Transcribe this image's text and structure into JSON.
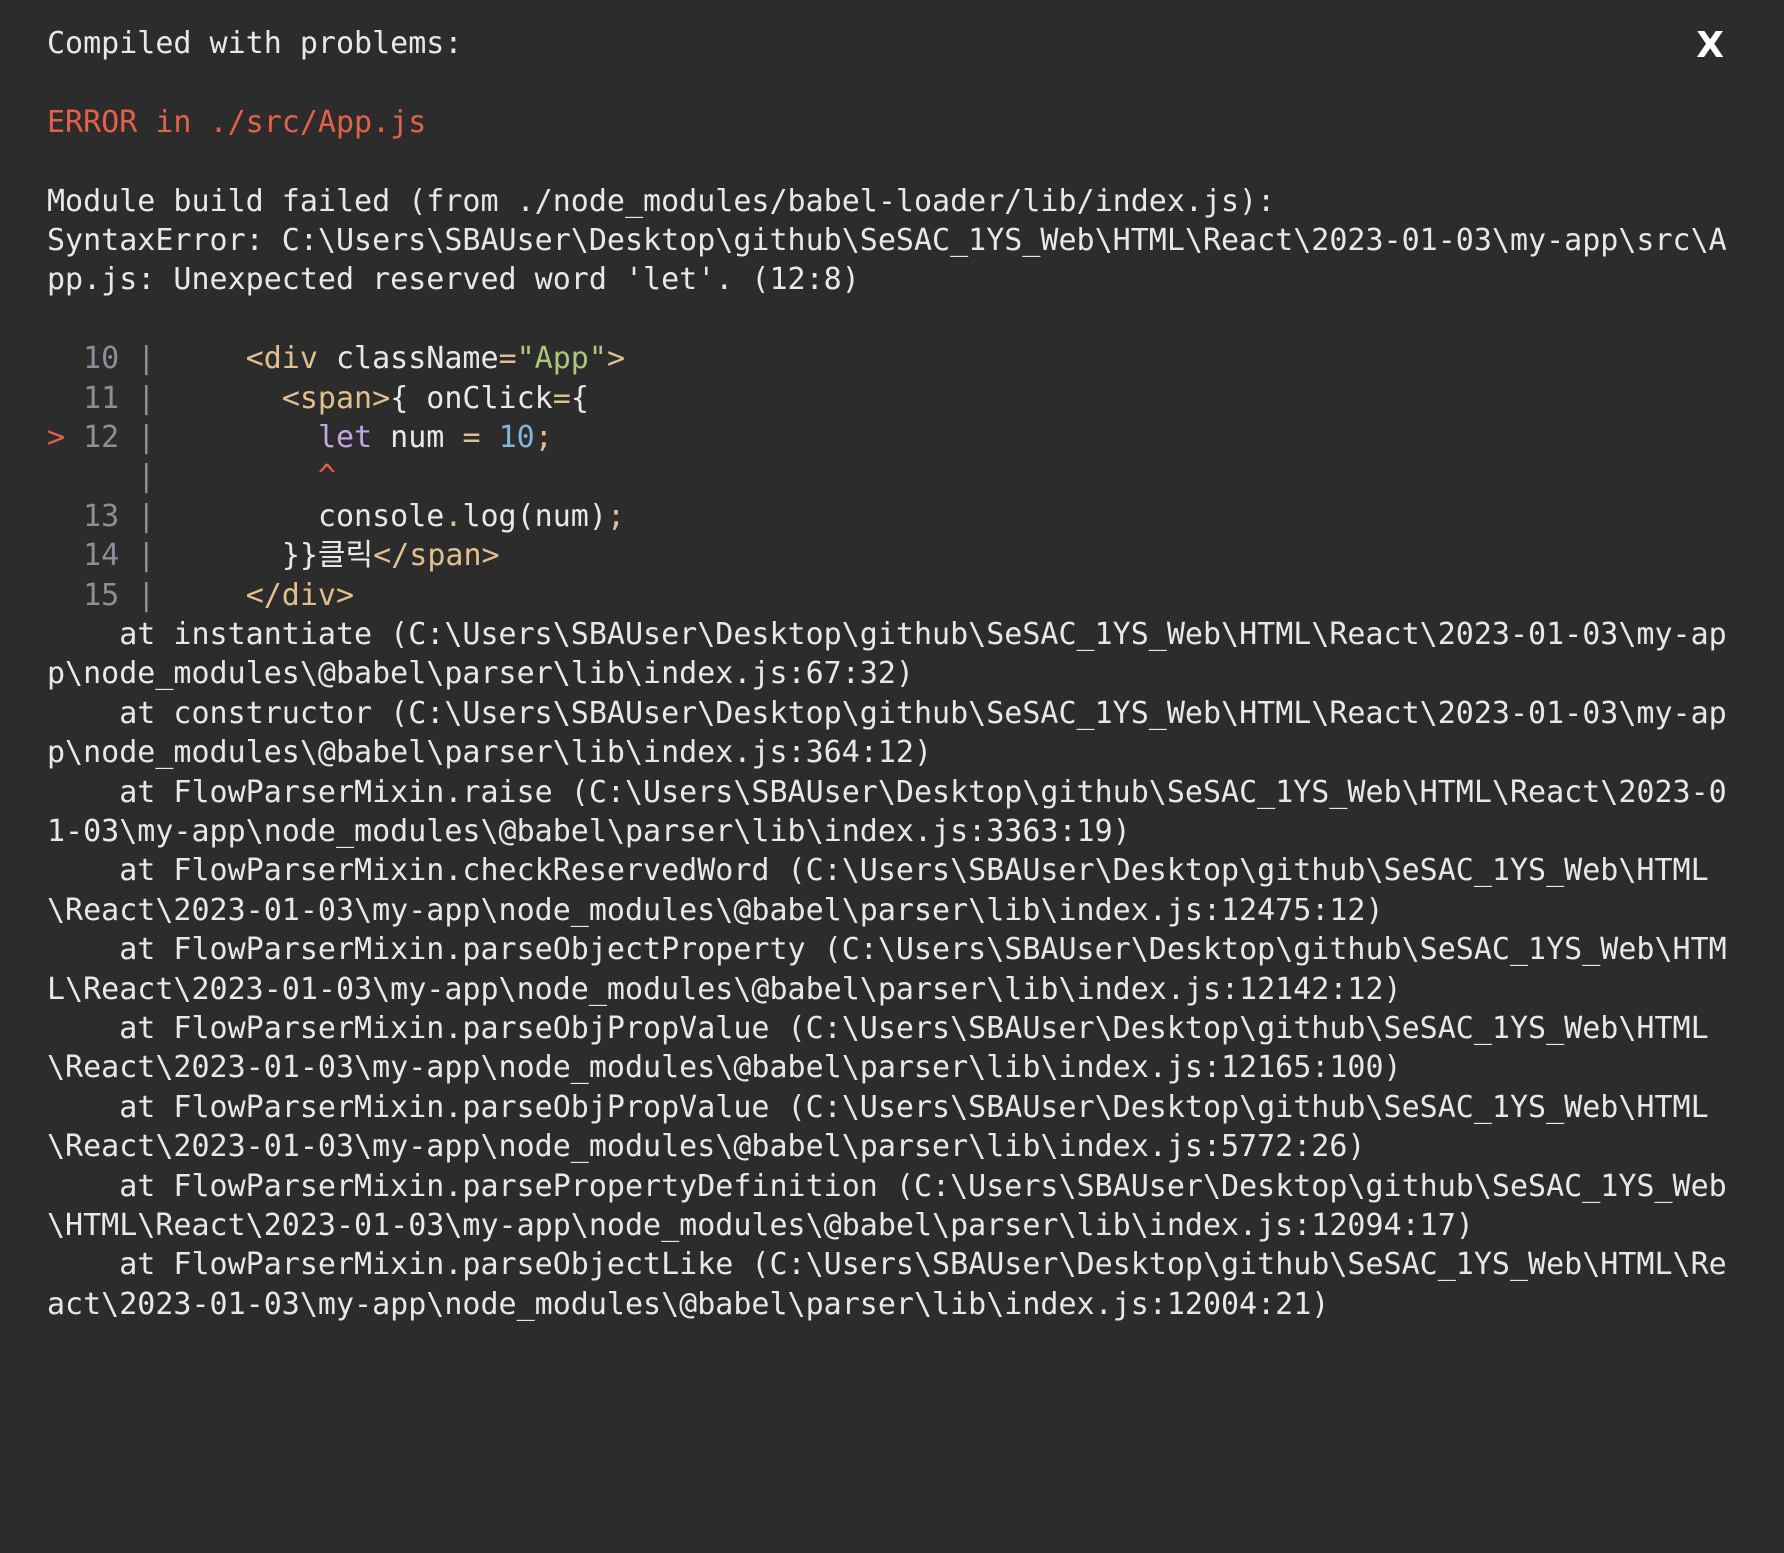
{
  "overlay": {
    "heading": "Compiled with problems:",
    "close_label": "X",
    "error_title": "ERROR in ./src/App.js",
    "message_lines": [
      "Module build failed (from ./node_modules/babel-loader/lib/index.js):",
      "SyntaxError: C:\\Users\\SBAUser\\Desktop\\github\\SeSAC_1YS_Web\\HTML\\React\\2023-01-03\\my-app\\src\\App.js: Unexpected reserved word 'let'. (12:8)"
    ],
    "code_frame": {
      "pointer": ">",
      "separator": "|",
      "caret": "^",
      "lines": [
        {
          "num": "10",
          "indent": "    ",
          "text": "<div className=\"App\">"
        },
        {
          "num": "11",
          "indent": "      ",
          "text": "<span>{ onClick={"
        },
        {
          "num": "12",
          "indent": "        ",
          "text": "let num = 10;"
        },
        {
          "num": "13",
          "indent": "        ",
          "text": "console.log(num);"
        },
        {
          "num": "14",
          "indent": "      ",
          "text": "}}클릭</span>"
        },
        {
          "num": "15",
          "indent": "    ",
          "text": "</div>"
        }
      ]
    },
    "stack": [
      "    at instantiate (C:\\Users\\SBAUser\\Desktop\\github\\SeSAC_1YS_Web\\HTML\\React\\2023-01-03\\my-app\\node_modules\\@babel\\parser\\lib\\index.js:67:32)",
      "    at constructor (C:\\Users\\SBAUser\\Desktop\\github\\SeSAC_1YS_Web\\HTML\\React\\2023-01-03\\my-app\\node_modules\\@babel\\parser\\lib\\index.js:364:12)",
      "    at FlowParserMixin.raise (C:\\Users\\SBAUser\\Desktop\\github\\SeSAC_1YS_Web\\HTML\\React\\2023-01-03\\my-app\\node_modules\\@babel\\parser\\lib\\index.js:3363:19)",
      "    at FlowParserMixin.checkReservedWord (C:\\Users\\SBAUser\\Desktop\\github\\SeSAC_1YS_Web\\HTML\\React\\2023-01-03\\my-app\\node_modules\\@babel\\parser\\lib\\index.js:12475:12)",
      "    at FlowParserMixin.parseObjectProperty (C:\\Users\\SBAUser\\Desktop\\github\\SeSAC_1YS_Web\\HTML\\React\\2023-01-03\\my-app\\node_modules\\@babel\\parser\\lib\\index.js:12142:12)",
      "    at FlowParserMixin.parseObjPropValue (C:\\Users\\SBAUser\\Desktop\\github\\SeSAC_1YS_Web\\HTML\\React\\2023-01-03\\my-app\\node_modules\\@babel\\parser\\lib\\index.js:12165:100)",
      "    at FlowParserMixin.parseObjPropValue (C:\\Users\\SBAUser\\Desktop\\github\\SeSAC_1YS_Web\\HTML\\React\\2023-01-03\\my-app\\node_modules\\@babel\\parser\\lib\\index.js:5772:26)",
      "    at FlowParserMixin.parsePropertyDefinition (C:\\Users\\SBAUser\\Desktop\\github\\SeSAC_1YS_Web\\HTML\\React\\2023-01-03\\my-app\\node_modules\\@babel\\parser\\lib\\index.js:12094:17)",
      "    at FlowParserMixin.parseObjectLike (C:\\Users\\SBAUser\\Desktop\\github\\SeSAC_1YS_Web\\HTML\\React\\2023-01-03\\my-app\\node_modules\\@babel\\parser\\lib\\index.js:12004:21)"
    ]
  },
  "colors": {
    "background": "#2c2c2c",
    "error": "#e36049",
    "text": "#e8e8e8"
  }
}
